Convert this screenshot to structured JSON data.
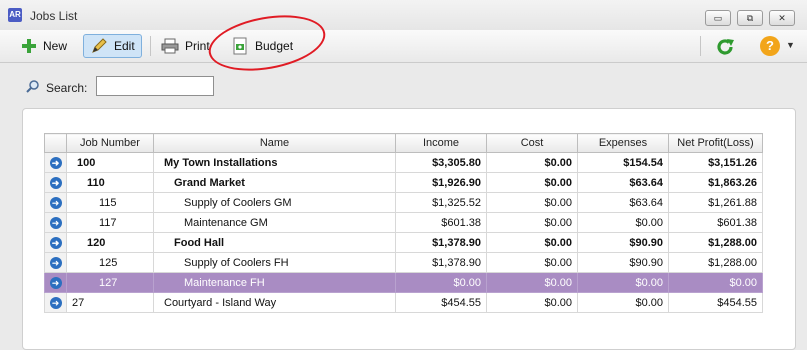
{
  "window": {
    "title": "Jobs List",
    "app_badge": "AR"
  },
  "title_buttons": {
    "minimize": "▭",
    "restore": "⧉",
    "close": "✕"
  },
  "toolbar": {
    "new_label": "New",
    "edit_label": "Edit",
    "print_label": "Print",
    "budget_label": "Budget",
    "help_label": "?"
  },
  "search": {
    "label": "Search:",
    "value": ""
  },
  "table": {
    "columns": [
      "",
      "Job Number",
      "Name",
      "Income",
      "Cost",
      "Expenses",
      "Net Profit(Loss)"
    ],
    "rows": [
      {
        "job": "100",
        "name": "My Town Installations",
        "income": "$3,305.80",
        "cost": "$0.00",
        "expenses": "$154.54",
        "net": "$3,151.26"
      },
      {
        "job": "110",
        "name": "Grand Market",
        "income": "$1,926.90",
        "cost": "$0.00",
        "expenses": "$63.64",
        "net": "$1,863.26"
      },
      {
        "job": "115",
        "name": "Supply of Coolers GM",
        "income": "$1,325.52",
        "cost": "$0.00",
        "expenses": "$63.64",
        "net": "$1,261.88"
      },
      {
        "job": "117",
        "name": "Maintenance GM",
        "income": "$601.38",
        "cost": "$0.00",
        "expenses": "$0.00",
        "net": "$601.38"
      },
      {
        "job": "120",
        "name": "Food Hall",
        "income": "$1,378.90",
        "cost": "$0.00",
        "expenses": "$90.90",
        "net": "$1,288.00"
      },
      {
        "job": "125",
        "name": "Supply of Coolers FH",
        "income": "$1,378.90",
        "cost": "$0.00",
        "expenses": "$90.90",
        "net": "$1,288.00"
      },
      {
        "job": "127",
        "name": "Maintenance FH",
        "income": "$0.00",
        "cost": "$0.00",
        "expenses": "$0.00",
        "net": "$0.00"
      },
      {
        "job": "27",
        "name": "Courtyard - Island Way",
        "income": "$454.55",
        "cost": "$0.00",
        "expenses": "$0.00",
        "net": "$454.55"
      }
    ]
  },
  "colors": {
    "selected_row": "#a98cc3",
    "annotation": "#e01b24",
    "row_arrow": "#2c6fc0"
  }
}
